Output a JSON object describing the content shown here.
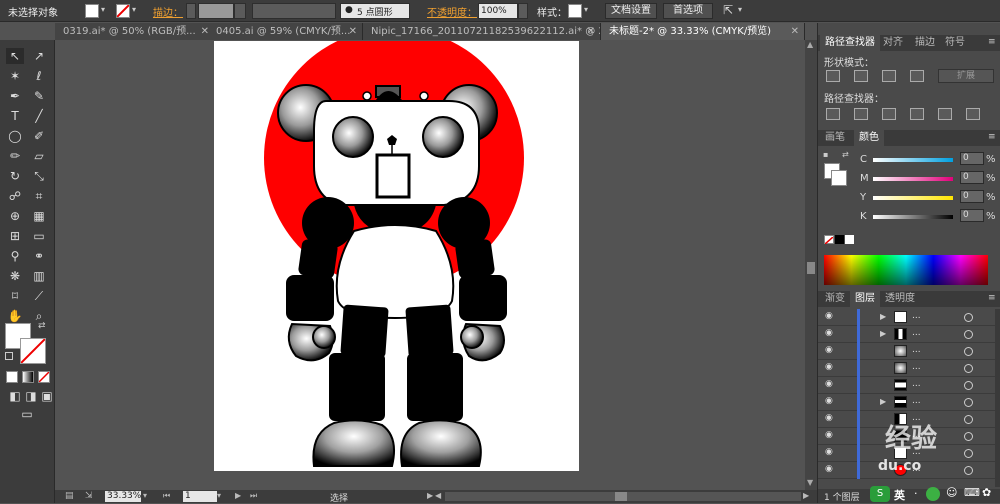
{
  "control_bar": {
    "selection_label": "未选择对象",
    "stroke_label": "描边：",
    "brush_label": "5 点圆形",
    "opacity_label": "不透明度：",
    "opacity_value": "100%",
    "style_label": "样式：",
    "doc_settings": "文档设置",
    "preferences": "首选项"
  },
  "tabs": [
    {
      "label": "0319.ai* @ 50% (RGB/预..."
    },
    {
      "label": "0405.ai @ 59% (CMYK/预..."
    },
    {
      "label": "Nipic_17166_20110721182539622112.ai* @ 2..."
    },
    {
      "label": "未标题-2* @ 33.33% (CMYK/预览)"
    }
  ],
  "status_bar": {
    "zoom": "33.33%",
    "page": "1",
    "tool": "选择"
  },
  "pathfinder_panel": {
    "tabs": [
      "路径查找器",
      "对齐",
      "描边",
      "符号"
    ],
    "shape_modes_label": "形状模式：",
    "expand_button": "扩展",
    "pathfinders_label": "路径查找器："
  },
  "color_panel": {
    "tabs": [
      "画笔",
      "颜色"
    ],
    "channels": [
      {
        "name": "C",
        "value": "0",
        "unit": "%"
      },
      {
        "name": "M",
        "value": "0",
        "unit": "%"
      },
      {
        "name": "Y",
        "value": "0",
        "unit": "%"
      },
      {
        "name": "K",
        "value": "0",
        "unit": "%"
      }
    ]
  },
  "layers_panel": {
    "tabs": [
      "渐变",
      "图层",
      "透明度"
    ],
    "layer_dots": "...",
    "footer": "1 个图层"
  },
  "watermark": {
    "brand": "经验",
    "domain": "du.co"
  },
  "ime": {
    "label": "英"
  },
  "colors": {
    "accent_red": "#ff0000",
    "panel_bg": "#4a4a4a",
    "canvas_bg": "#535353"
  }
}
